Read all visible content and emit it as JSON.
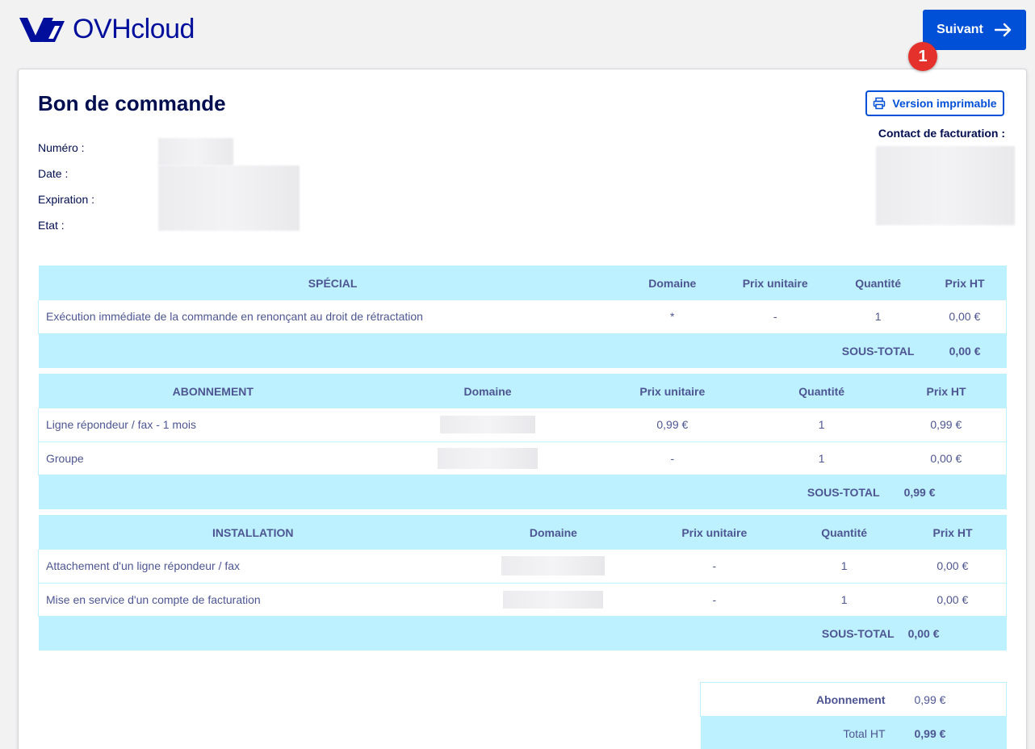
{
  "brand": {
    "name": "OVHcloud",
    "color": "#000e9c",
    "icon": "ovh-logo-icon"
  },
  "header": {
    "next_label": "Suivant",
    "next_icon": "arrow-right-icon",
    "badge": "1"
  },
  "order": {
    "title": "Bon de commande",
    "print_label": "Version imprimable",
    "print_icon": "printer-icon",
    "contact_label": "Contact de facturation :",
    "meta_labels": [
      "Numéro :",
      "Date :",
      "Expiration :",
      "Etat :"
    ]
  },
  "sections": [
    {
      "headers": [
        "SPÉCIAL",
        "Domaine",
        "Prix unitaire",
        "Quantité",
        "Prix HT"
      ],
      "rows": [
        {
          "label": "Exécution immédiate de la commande en renonçant au droit de rétractation",
          "domain": "*",
          "unit_price": "-",
          "quantity": "1",
          "price": "0,00 €"
        }
      ],
      "subtotal_label": "SOUS-TOTAL",
      "subtotal": "0,00 €"
    },
    {
      "headers": [
        "ABONNEMENT",
        "Domaine",
        "Prix unitaire",
        "Quantité",
        "Prix HT"
      ],
      "rows": [
        {
          "label": "Ligne répondeur / fax - 1 mois",
          "domain": "",
          "unit_price": "0,99 €",
          "quantity": "1",
          "price": "0,99 €"
        },
        {
          "label": "Groupe",
          "domain": "",
          "unit_price": "-",
          "quantity": "1",
          "price": "0,00 €"
        }
      ],
      "subtotal_label": "SOUS-TOTAL",
      "subtotal": "0,99 €"
    },
    {
      "headers": [
        "INSTALLATION",
        "Domaine",
        "Prix unitaire",
        "Quantité",
        "Prix HT"
      ],
      "rows": [
        {
          "label": "Attachement d'un ligne répondeur / fax",
          "domain": "",
          "unit_price": "-",
          "quantity": "1",
          "price": "0,00 €"
        },
        {
          "label": "Mise en service d'un compte de facturation",
          "domain": "",
          "unit_price": "-",
          "quantity": "1",
          "price": "0,00 €"
        }
      ],
      "subtotal_label": "SOUS-TOTAL",
      "subtotal": "0,00 €"
    }
  ],
  "totals": {
    "subscription_label": "Abonnement",
    "subscription": "0,99 €",
    "total_label": "Total HT",
    "total": "0,99 €"
  },
  "colors": {
    "accent": "#0050d7",
    "table_header": "#bef1ff",
    "badge": "#e5312b",
    "text": "#4d5693",
    "heading": "#000d4f"
  }
}
